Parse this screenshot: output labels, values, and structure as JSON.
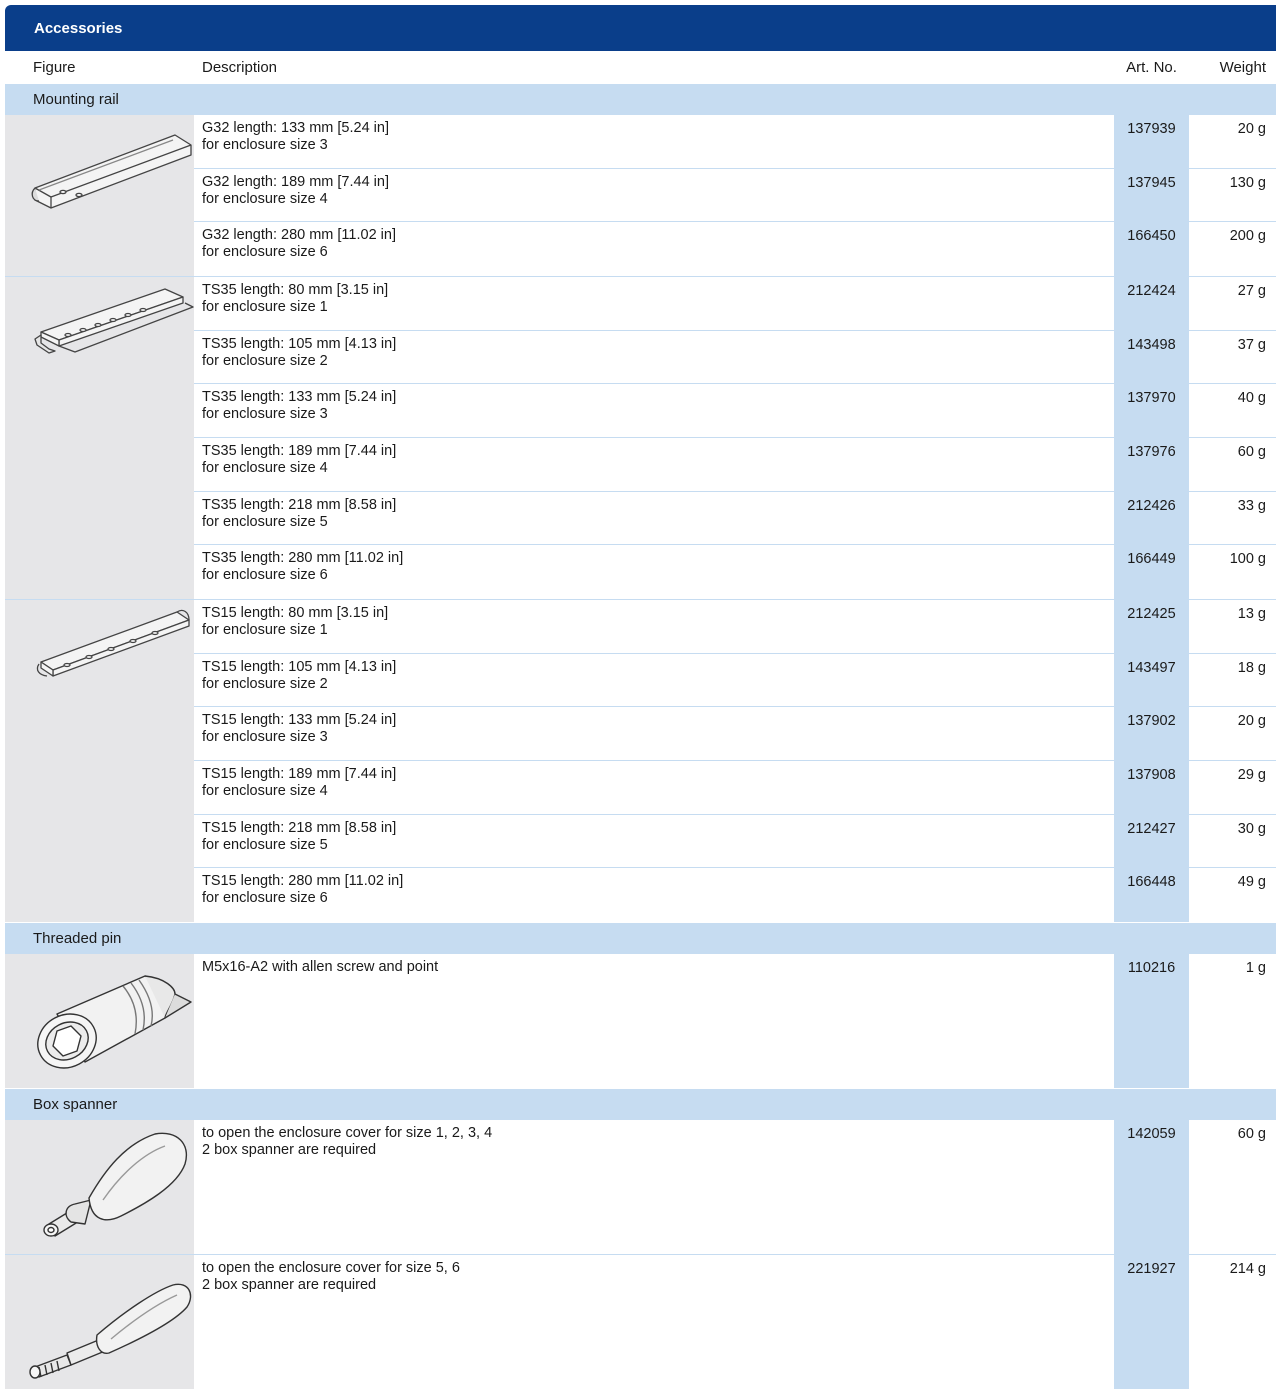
{
  "title": "Accessories",
  "headers": {
    "figure": "Figure",
    "description": "Description",
    "art_no": "Art. No.",
    "weight": "Weight"
  },
  "sections": [
    {
      "name": "Mounting rail",
      "groups": [
        {
          "figure_icon": "g32-rail-icon",
          "rows": [
            {
              "line1": "G32 length: 133 mm [5.24 in]",
              "line2": "for enclosure size 3",
              "art_no": "137939",
              "weight": "20 g"
            },
            {
              "line1": "G32 length: 189 mm [7.44 in]",
              "line2": "for enclosure size 4",
              "art_no": "137945",
              "weight": "130 g"
            },
            {
              "line1": "G32 length: 280 mm [11.02 in]",
              "line2": "for enclosure size 6",
              "art_no": "166450",
              "weight": "200 g"
            }
          ]
        },
        {
          "figure_icon": "ts35-rail-icon",
          "rows": [
            {
              "line1": "TS35 length: 80 mm [3.15 in]",
              "line2": "for enclosure size 1",
              "art_no": "212424",
              "weight": "27 g"
            },
            {
              "line1": "TS35 length: 105 mm [4.13 in]",
              "line2": "for enclosure size 2",
              "art_no": "143498",
              "weight": "37 g"
            },
            {
              "line1": "TS35 length: 133 mm [5.24 in]",
              "line2": "for enclosure size 3",
              "art_no": "137970",
              "weight": "40 g"
            },
            {
              "line1": "TS35 length: 189 mm [7.44 in]",
              "line2": "for enclosure size 4",
              "art_no": "137976",
              "weight": "60 g"
            },
            {
              "line1": "TS35 length: 218 mm [8.58 in]",
              "line2": "for enclosure size 5",
              "art_no": "212426",
              "weight": "33 g"
            },
            {
              "line1": "TS35 length: 280 mm [11.02 in]",
              "line2": "for enclosure size 6",
              "art_no": "166449",
              "weight": "100 g"
            }
          ]
        },
        {
          "figure_icon": "ts15-rail-icon",
          "rows": [
            {
              "line1": "TS15 length: 80 mm [3.15 in]",
              "line2": "for enclosure size 1",
              "art_no": "212425",
              "weight": "13 g"
            },
            {
              "line1": "TS15 length: 105 mm [4.13 in]",
              "line2": "for enclosure size 2",
              "art_no": "143497",
              "weight": "18 g"
            },
            {
              "line1": "TS15 length: 133 mm [5.24 in]",
              "line2": "for enclosure size 3",
              "art_no": "137902",
              "weight": "20 g"
            },
            {
              "line1": "TS15 length: 189 mm [7.44 in]",
              "line2": "for enclosure size 4",
              "art_no": "137908",
              "weight": "29 g"
            },
            {
              "line1": "TS15 length: 218 mm [8.58 in]",
              "line2": "for enclosure size 5",
              "art_no": "212427",
              "weight": "30 g"
            },
            {
              "line1": "TS15 length: 280 mm [11.02 in]",
              "line2": "for enclosure size 6",
              "art_no": "166448",
              "weight": "49 g"
            }
          ]
        }
      ]
    },
    {
      "name": "Threaded pin",
      "groups": [
        {
          "figure_icon": "threaded-pin-icon",
          "rows": [
            {
              "line1": "M5x16-A2 with allen screw and point",
              "line2": "",
              "art_no": "110216",
              "weight": "1 g"
            }
          ]
        }
      ]
    },
    {
      "name": "Box spanner",
      "groups": [
        {
          "figure_icon": "box-spanner-small-icon",
          "rows": [
            {
              "line1": "to open the enclosure cover for size 1, 2, 3, 4",
              "line2": "2 box spanner are required",
              "art_no": "142059",
              "weight": "60 g"
            }
          ]
        },
        {
          "figure_icon": "box-spanner-large-icon",
          "rows": [
            {
              "line1": "to open the enclosure cover for size 5, 6",
              "line2": "2 box spanner are required",
              "art_no": "221927",
              "weight": "214 g"
            }
          ]
        }
      ]
    }
  ],
  "colors": {
    "title_bar": "#0a3e8a",
    "section_bg": "#c6dcf1",
    "figure_bg": "#e6e6e8"
  }
}
